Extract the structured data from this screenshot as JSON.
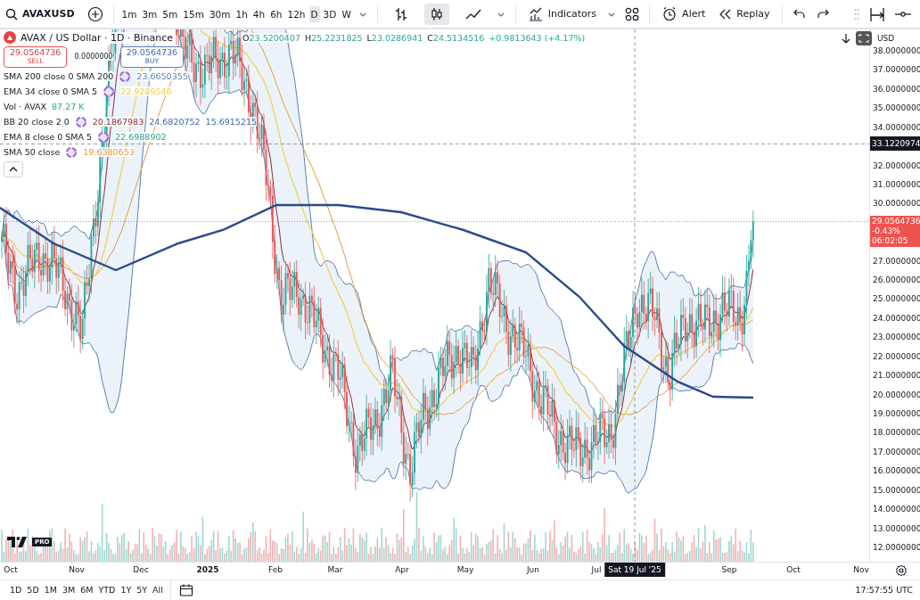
{
  "toolbar": {
    "symbol": "AVAXUSD",
    "intervals": [
      {
        "label": "1m",
        "selected": false
      },
      {
        "label": "3m",
        "selected": false
      },
      {
        "label": "5m",
        "selected": false
      },
      {
        "label": "15m",
        "selected": false
      },
      {
        "label": "30m",
        "selected": false
      },
      {
        "label": "1h",
        "selected": false
      },
      {
        "label": "4h",
        "selected": false
      },
      {
        "label": "6h",
        "selected": false
      },
      {
        "label": "12h",
        "selected": false
      },
      {
        "label": "D",
        "selected": true
      },
      {
        "label": "3D",
        "selected": false
      },
      {
        "label": "W",
        "selected": false
      }
    ],
    "chart_types": [
      {
        "kind": "bars",
        "selected": false
      },
      {
        "kind": "candles",
        "selected": true
      },
      {
        "kind": "line",
        "selected": false
      }
    ],
    "indicators_label": "Indicators",
    "alert_label": "Alert",
    "replay_label": "Replay"
  },
  "legend": {
    "title": "AVAX / US Dollar · 1D · Binance",
    "ohlc": [
      {
        "prefix": "O",
        "value": "23.5200407"
      },
      {
        "prefix": "H",
        "value": "25.2231825"
      },
      {
        "prefix": "L",
        "value": "23.0286941"
      },
      {
        "prefix": "C",
        "value": "24.5134516"
      }
    ],
    "change": "+0.9813643 (+4.17%)",
    "sell": {
      "price": "29.0564736",
      "label": "SELL"
    },
    "spread": "0.0000000",
    "buy": {
      "price": "29.0564736",
      "label": "BUY"
    },
    "indicators": [
      {
        "name": "SMA 200 close 0 SMA 200",
        "settings_icon": true,
        "values": [
          {
            "text": "23.6650355",
            "color": "#5b7fb5"
          }
        ]
      },
      {
        "name": "EMA 34 close 0 SMA 5",
        "settings_icon": true,
        "values": [
          {
            "text": "22.9289546",
            "color": "#f2d04b"
          }
        ]
      },
      {
        "name": "Vol · AVAX",
        "settings_icon": false,
        "values": [
          {
            "text": "87.27 K",
            "color": "#26a69a"
          }
        ]
      },
      {
        "name": "BB 20 close 2 0",
        "settings_icon": true,
        "values": [
          {
            "text": "20.1867983",
            "color": "#8b2f3c"
          },
          {
            "text": "24.6820752",
            "color": "#3a6aa8"
          },
          {
            "text": "15.6915215",
            "color": "#3a6aa8"
          }
        ]
      },
      {
        "name": "EMA 8 close 0 SMA 5",
        "settings_icon": true,
        "values": [
          {
            "text": "22.6988902",
            "color": "#2a9d8f"
          }
        ]
      },
      {
        "name": "SMA 50 close",
        "settings_icon": true,
        "values": [
          {
            "text": "19.6380653",
            "color": "#e39b3a"
          }
        ]
      }
    ]
  },
  "price_axis": {
    "currency": "USD",
    "labels": [
      {
        "text": "38.0000000",
        "kind": "tick"
      },
      {
        "text": "37.0000000",
        "kind": "tick"
      },
      {
        "text": "36.0000000",
        "kind": "tick"
      },
      {
        "text": "35.0000000",
        "kind": "tick"
      },
      {
        "text": "34.0000000",
        "kind": "tick"
      },
      {
        "text": "33.1220974",
        "kind": "crosshair"
      },
      {
        "text": "32.0000000",
        "kind": "tick"
      },
      {
        "text": "31.0000000",
        "kind": "tick"
      },
      {
        "text": "30.0000000",
        "kind": "tick"
      },
      {
        "text": "29.0564736",
        "kind": "last-price",
        "change": "-0.43%",
        "countdown": "06:02:05"
      },
      {
        "text": "27.0000000",
        "kind": "tick"
      },
      {
        "text": "26.0000000",
        "kind": "tick"
      },
      {
        "text": "25.0000000",
        "kind": "tick"
      },
      {
        "text": "24.0000000",
        "kind": "tick"
      },
      {
        "text": "23.0000000",
        "kind": "tick"
      },
      {
        "text": "22.0000000",
        "kind": "tick"
      },
      {
        "text": "21.0000000",
        "kind": "tick"
      },
      {
        "text": "20.0000000",
        "kind": "tick"
      },
      {
        "text": "19.0000000",
        "kind": "tick"
      },
      {
        "text": "18.0000000",
        "kind": "tick"
      },
      {
        "text": "17.0000000",
        "kind": "tick"
      },
      {
        "text": "16.0000000",
        "kind": "tick"
      },
      {
        "text": "15.0000000",
        "kind": "tick"
      },
      {
        "text": "14.0000000",
        "kind": "tick"
      },
      {
        "text": "13.0000000",
        "kind": "tick"
      },
      {
        "text": "12.0000000",
        "kind": "tick"
      }
    ]
  },
  "logo_badge": "PRO",
  "time_axis": {
    "labels": [
      {
        "text": "Oct",
        "bold": false
      },
      {
        "text": "Nov",
        "bold": false
      },
      {
        "text": "Dec",
        "bold": false
      },
      {
        "text": "2025",
        "bold": true
      },
      {
        "text": "Feb",
        "bold": false
      },
      {
        "text": "Mar",
        "bold": false
      },
      {
        "text": "Apr",
        "bold": false
      },
      {
        "text": "May",
        "bold": false
      },
      {
        "text": "Jun",
        "bold": false
      },
      {
        "text": "Jul",
        "bold": false
      },
      {
        "text": "Sep",
        "bold": false
      },
      {
        "text": "Oct",
        "bold": false
      },
      {
        "text": "Nov",
        "bold": false
      }
    ],
    "crosshair_label": "Sat 19 Jul '25"
  },
  "ranges": [
    "1D",
    "5D",
    "1M",
    "3M",
    "6M",
    "YTD",
    "1Y",
    "5Y",
    "All"
  ],
  "clock": "17:57:55 UTC"
}
